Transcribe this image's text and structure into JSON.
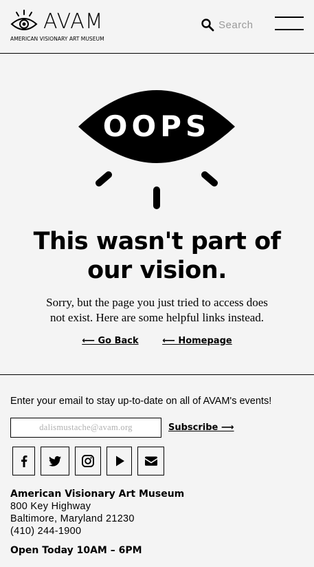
{
  "header": {
    "logo_word": "AVAM",
    "logo_sub": "AMERICAN VISIONARY ART MUSEUM",
    "search_label": "Search"
  },
  "error": {
    "graphic_text": "OOPS",
    "headline_line1": "This wasn't part of",
    "headline_line2": "our vision.",
    "message_line1": "Sorry, but the page you just tried to access does",
    "message_line2": "not exist. Here are some helpful links instead.",
    "links": [
      {
        "label": "⟵ Go Back"
      },
      {
        "label": "⟵ Homepage"
      }
    ]
  },
  "footer": {
    "newsletter_text": "Enter your email to stay up-to-date on all of AVAM's events!",
    "email_placeholder": "dalismustache@avam.org",
    "subscribe_label": "Subscribe ⟶",
    "social": [
      "facebook-icon",
      "twitter-icon",
      "instagram-icon",
      "youtube-icon",
      "email-icon"
    ],
    "org_name": "American Visionary Art Museum",
    "address_line1": "800 Key Highway",
    "address_line2": "Baltimore, Maryland 21230",
    "phone": "(410) 244-1900",
    "hours": "Open Today 10AM – 6PM"
  }
}
